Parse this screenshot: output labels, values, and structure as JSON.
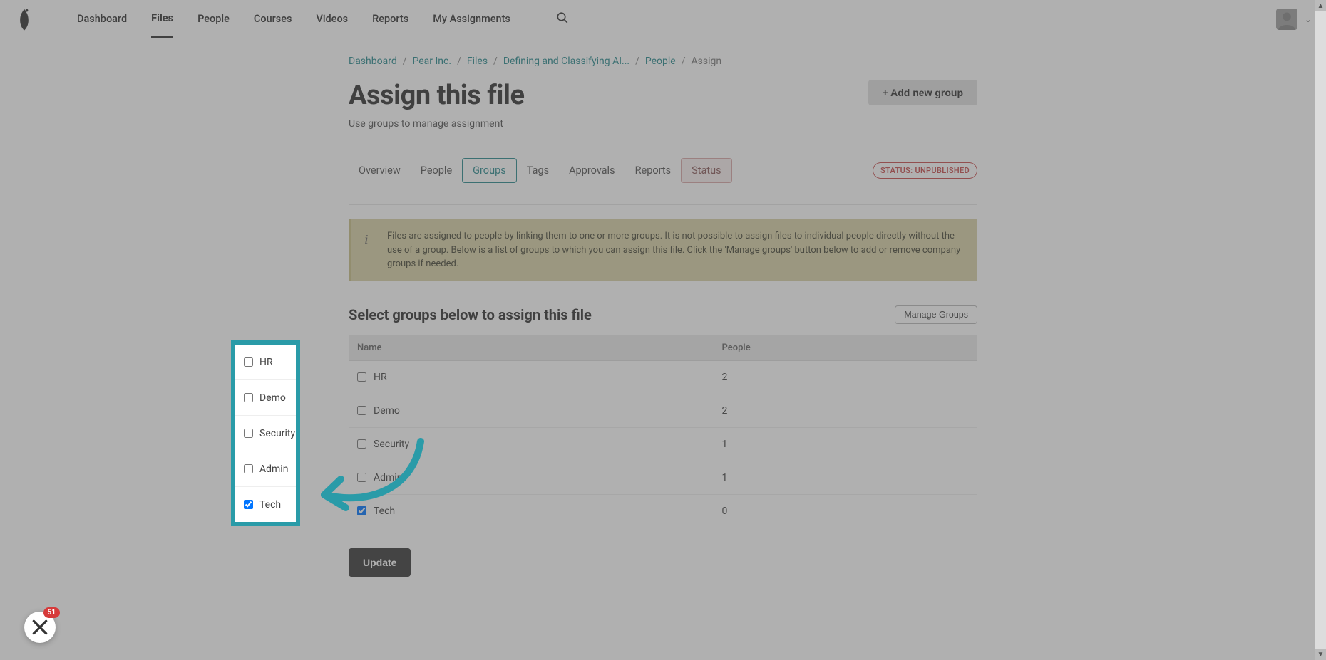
{
  "nav": {
    "items": [
      "Dashboard",
      "Files",
      "People",
      "Courses",
      "Videos",
      "Reports",
      "My Assignments"
    ],
    "active_index": 1
  },
  "breadcrumb": {
    "items": [
      {
        "label": "Dashboard",
        "link": true
      },
      {
        "label": "Pear Inc.",
        "link": true
      },
      {
        "label": "Files",
        "link": true
      },
      {
        "label": "Defining and Classifying AI...",
        "link": true
      },
      {
        "label": "People",
        "link": true
      },
      {
        "label": "Assign",
        "link": false
      }
    ]
  },
  "page": {
    "title": "Assign this file",
    "subtitle": "Use groups to manage assignment",
    "add_group_label": "+ Add new group"
  },
  "tabs": {
    "items": [
      "Overview",
      "People",
      "Groups",
      "Tags",
      "Approvals",
      "Reports",
      "Status"
    ],
    "active_index": 2,
    "status_index": 6
  },
  "status_badge": "STATUS: UNPUBLISHED",
  "info_text": "Files are assigned to people by linking them to one or more groups. It is not possible to assign files to individual people directly without the use of a group. Below is a list of groups to which you can assign this file. Click the 'Manage groups' button below to add or remove company groups if needed.",
  "section": {
    "title": "Select groups below to assign this file",
    "manage_label": "Manage Groups"
  },
  "table": {
    "headers": {
      "name": "Name",
      "people": "People"
    },
    "rows": [
      {
        "name": "HR",
        "people": "2",
        "checked": false
      },
      {
        "name": "Demo",
        "people": "2",
        "checked": false
      },
      {
        "name": "Security",
        "people": "1",
        "checked": false
      },
      {
        "name": "Admin",
        "people": "1",
        "checked": false
      },
      {
        "name": "Tech",
        "people": "0",
        "checked": true
      }
    ]
  },
  "update_label": "Update",
  "widget_count": "51"
}
